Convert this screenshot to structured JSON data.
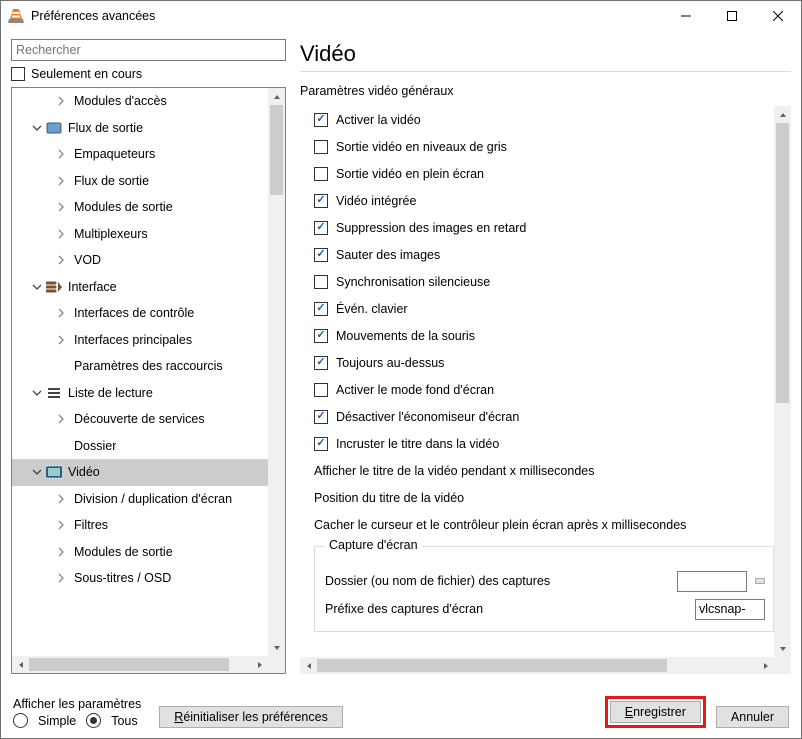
{
  "window": {
    "title": "Préférences avancées"
  },
  "left": {
    "search_placeholder": "Rechercher",
    "only_current": "Seulement en cours",
    "tree": [
      {
        "level": 1,
        "caret": ">",
        "icon": "",
        "label": "Modules d'accès"
      },
      {
        "level": 0,
        "caret": "v",
        "icon": "stream",
        "label": "Flux de sortie"
      },
      {
        "level": 1,
        "caret": ">",
        "icon": "",
        "label": "Empaqueteurs"
      },
      {
        "level": 1,
        "caret": ">",
        "icon": "",
        "label": "Flux de sortie"
      },
      {
        "level": 1,
        "caret": ">",
        "icon": "",
        "label": "Modules de sortie"
      },
      {
        "level": 1,
        "caret": ">",
        "icon": "",
        "label": "Multiplexeurs"
      },
      {
        "level": 1,
        "caret": ">",
        "icon": "",
        "label": "VOD"
      },
      {
        "level": 0,
        "caret": "v",
        "icon": "interface",
        "label": "Interface"
      },
      {
        "level": 1,
        "caret": ">",
        "icon": "",
        "label": "Interfaces de contrôle"
      },
      {
        "level": 1,
        "caret": ">",
        "icon": "",
        "label": "Interfaces principales"
      },
      {
        "level": 1,
        "caret": "",
        "icon": "",
        "label": "Paramètres des raccourcis"
      },
      {
        "level": 0,
        "caret": "v",
        "icon": "playlist",
        "label": "Liste de lecture"
      },
      {
        "level": 1,
        "caret": ">",
        "icon": "",
        "label": "Découverte de services"
      },
      {
        "level": 1,
        "caret": "",
        "icon": "",
        "label": "Dossier"
      },
      {
        "level": 0,
        "caret": "v",
        "icon": "video",
        "label": "Vidéo",
        "selected": true
      },
      {
        "level": 1,
        "caret": ">",
        "icon": "",
        "label": "Division / duplication d'écran"
      },
      {
        "level": 1,
        "caret": ">",
        "icon": "",
        "label": "Filtres"
      },
      {
        "level": 1,
        "caret": ">",
        "icon": "",
        "label": "Modules de sortie"
      },
      {
        "level": 1,
        "caret": ">",
        "icon": "",
        "label": "Sous-titres / OSD"
      }
    ]
  },
  "page": {
    "title": "Vidéo",
    "general_section": "Paramètres vidéo généraux",
    "options": [
      {
        "checked": true,
        "label": "Activer la vidéo"
      },
      {
        "checked": false,
        "label": "Sortie vidéo en niveaux de gris"
      },
      {
        "checked": false,
        "label": "Sortie vidéo en plein écran"
      },
      {
        "checked": true,
        "label": "Vidéo intégrée"
      },
      {
        "checked": true,
        "label": "Suppression des images en retard"
      },
      {
        "checked": true,
        "label": "Sauter des images"
      },
      {
        "checked": false,
        "label": "Synchronisation silencieuse"
      },
      {
        "checked": true,
        "label": "Évén. clavier"
      },
      {
        "checked": true,
        "label": "Mouvements de la souris"
      },
      {
        "checked": true,
        "label": "Toujours au-dessus"
      },
      {
        "checked": false,
        "label": "Activer le mode fond d'écran"
      },
      {
        "checked": true,
        "label": "Désactiver l'économiseur d'écran"
      },
      {
        "checked": true,
        "label": "Incruster le titre dans la vidéo"
      }
    ],
    "labels": [
      "Afficher le titre de la vidéo pendant x millisecondes",
      "Position du titre de la vidéo",
      "Cacher le curseur et le contrôleur plein écran après x millisecondes"
    ],
    "groupbox": {
      "title": "Capture d'écran",
      "rows": [
        {
          "label": "Dossier (ou nom de fichier) des captures",
          "value": "",
          "browse": true
        },
        {
          "label": "Préfixe des captures d'écran",
          "value": "vlcsnap-"
        }
      ]
    }
  },
  "footer": {
    "show_title": "Afficher les paramètres",
    "simple": "Simple",
    "all": "Tous",
    "reset_u": "R",
    "reset_rest": "éinitialiser les préférences",
    "save_u": "E",
    "save_rest": "nregistrer",
    "cancel": "Annuler"
  }
}
